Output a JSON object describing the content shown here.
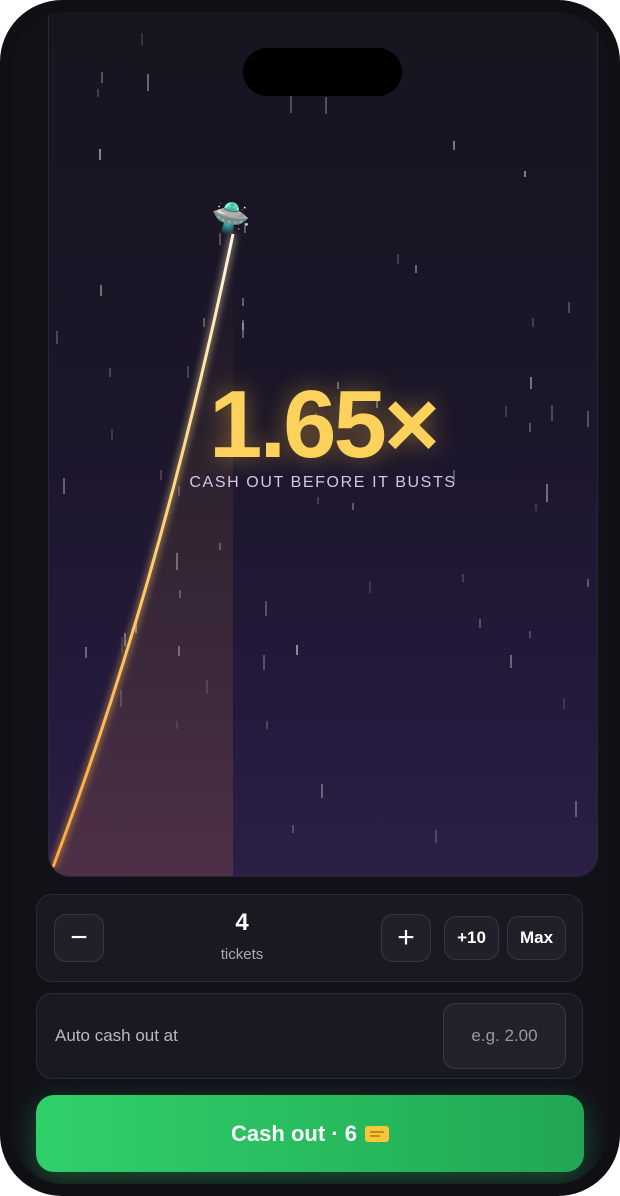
{
  "game": {
    "multiplier": "1.65×",
    "hint": "CASH OUT BEFORE IT BUSTS",
    "rocket_icon": "ufo-icon",
    "trail_color": "#ffc24a"
  },
  "tickets": {
    "decrement_label": "−",
    "count": "4",
    "unit_label": "tickets",
    "increment_label": "+",
    "plus_ten_label": "+10",
    "max_label": "Max"
  },
  "auto_cashout": {
    "label": "Auto cash out at",
    "placeholder": "e.g. 2.00",
    "value": ""
  },
  "cashout_button": {
    "label": "Cash out · 6",
    "icon": "ticket-icon",
    "color": "#2fd06a"
  }
}
